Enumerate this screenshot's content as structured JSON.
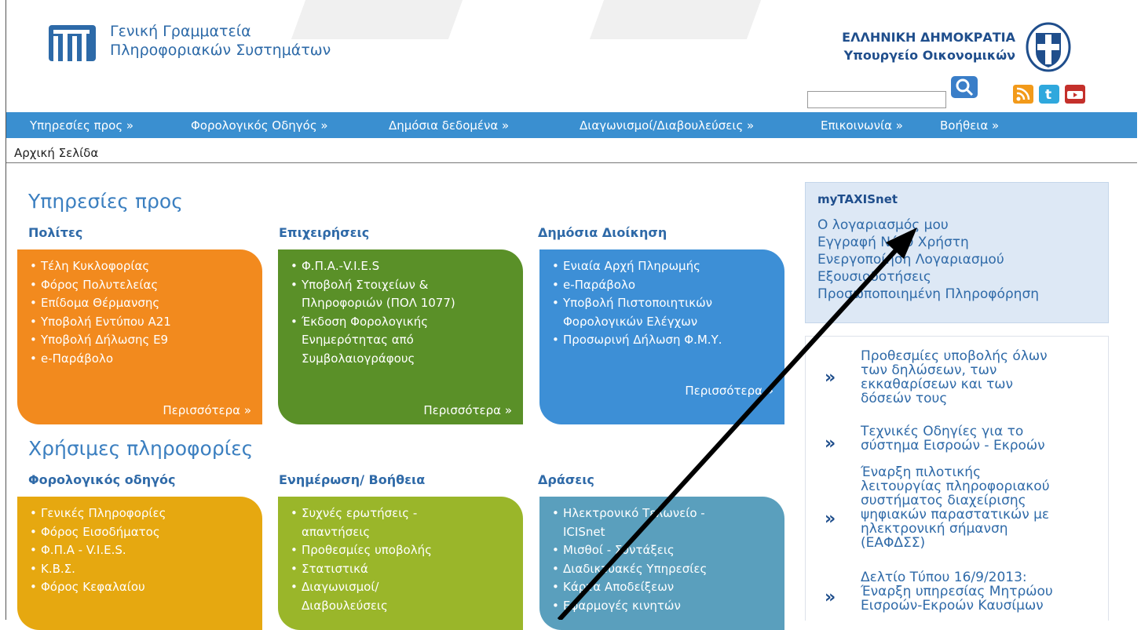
{
  "header": {
    "org_line1": "Γενική Γραμματεία",
    "org_line2": "Πληροφοριακών Συστημάτων",
    "republic": "ΕΛΛΗΝΙΚΗ ΔΗΜΟΚΡΑΤΙΑ",
    "ministry": "Υπουργείο Οικονομικών",
    "search_value": ""
  },
  "nav": [
    "Υπηρεσίες προς »",
    "Φορολογικός Οδηγός »",
    "Δημόσια δεδομένα »",
    "Διαγωνισμοί/Διαβουλεύσεις »",
    "Επικοινωνία »",
    "Βοήθεια »"
  ],
  "breadcrumb": "Αρχική Σελίδα",
  "services": {
    "title": "Υπηρεσίες προς",
    "citizens": {
      "heading": "Πολίτες",
      "items": [
        "Τέλη Κυκλοφορίας",
        "Φόρος Πολυτελείας",
        "Επίδομα Θέρμανσης",
        "Υποβολή Εντύπου Α21",
        "Υποβολή Δήλωσης Ε9",
        "e-Παράβολο"
      ],
      "more": "Περισσότερα »"
    },
    "business": {
      "heading": "Επιχειρήσεις",
      "items": [
        "Φ.Π.Α.-V.I.E.S",
        "Υποβολή Στοιχείων & Πληροφοριών (ΠΟΛ 1077)",
        "Έκδοση Φορολογικής Ενημερότητας από Συμβολαιογράφους"
      ],
      "more": "Περισσότερα »"
    },
    "public": {
      "heading": "Δημόσια Διοίκηση",
      "items": [
        "Ενιαία Αρχή Πληρωμής",
        "e-Παράβολο",
        "Υποβολή Πιστοποιητικών Φορολογικών Ελέγχων",
        "Προσωρινή Δήλωση Φ.Μ.Υ."
      ],
      "more": "Περισσότερα »"
    }
  },
  "info": {
    "title": "Χρήσιμες πληροφορίες",
    "tax": {
      "heading": "Φορολογικός οδηγός",
      "items": [
        "Γενικές Πληροφορίες",
        "Φόρος Εισοδήματος",
        "Φ.Π.Α - V.I.E.S.",
        "Κ.Β.Σ.",
        "Φόρος Κεφαλαίου"
      ]
    },
    "help": {
      "heading": "Ενημέρωση/ Βοήθεια",
      "items": [
        "Συχνές ερωτήσεις - απαντήσεις",
        "Προθεσμίες υποβολής",
        "Στατιστικά",
        "Διαγωνισμοί/ Διαβουλεύσεις"
      ]
    },
    "actions": {
      "heading": "Δράσεις",
      "items": [
        "Ηλεκτρονικό Τελωνείο - ICISnet",
        "Μισθοί - Συντάξεις",
        "Διαδικτυακές Υπηρεσίες",
        "Κάρτα Αποδείξεων",
        "Εφαρμογές κινητών"
      ]
    }
  },
  "mytaxisnet": {
    "title": "myTAXISnet",
    "links": [
      "Ο λογαριασμός μου",
      "Εγγραφή Νέου Χρήστη",
      "Ενεργοποίηση Λογαριασμού",
      "Εξουσιοδοτήσεις",
      "Προσωποποιημένη Πληροφόρηση"
    ]
  },
  "news": {
    "icon_glyph": "»",
    "items": [
      {
        "lines": [
          "Προθεσμίες υποβολής όλων",
          "των δηλώσεων, των",
          "εκκαθαρίσεων και των",
          "δόσεών τους"
        ]
      },
      {
        "lines": [
          "Τεχνικές Οδηγίες για το",
          "σύστημα Εισροών - Εκροών"
        ]
      },
      {
        "lines": [
          "Έναρξη πιλοτικής",
          "λειτουργίας πληροφοριακού",
          "συστήματος διαχείρισης",
          "ψηφιακών παραστατικών με",
          "ηλεκτρονική σήμανση",
          "(ΕΑΦΔΣΣ)"
        ]
      },
      {
        "lines": [
          "Δελτίο Τύπου 16/9/2013:",
          "Έναρξη υπηρεσίας Μητρώου",
          "Εισροών-Εκροών Καυσίμων"
        ]
      }
    ]
  },
  "colors": {
    "nav_blue": "#3a8fd0",
    "orange": "#f28a1e",
    "green": "#5a9028",
    "blue": "#3d8fd6",
    "gold": "#e6a810",
    "lime": "#9ab62a",
    "teal": "#5a9fbd"
  }
}
